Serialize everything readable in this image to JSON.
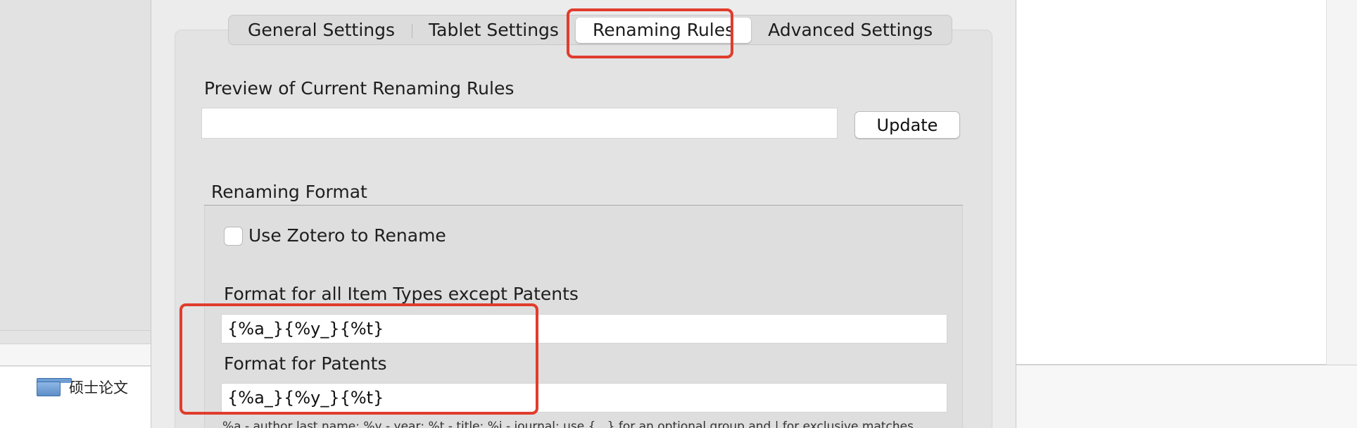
{
  "background_app": {
    "sidebar_folder_label": "硕士论文"
  },
  "tabs": [
    {
      "label": "General Settings",
      "active": false
    },
    {
      "label": "Tablet Settings",
      "active": false
    },
    {
      "label": "Renaming Rules",
      "active": true
    },
    {
      "label": "Advanced Settings",
      "active": false
    }
  ],
  "preview": {
    "label": "Preview of Current Renaming Rules",
    "value": "",
    "update_label": "Update"
  },
  "renaming_format": {
    "section_title": "Renaming Format",
    "use_zotero_label": "Use Zotero to Rename",
    "use_zotero_checked": false,
    "all_types_label": "Format for all Item Types except Patents",
    "all_types_value": "{%a_}{%y_}{%t}",
    "patents_label": "Format for Patents",
    "patents_value": "{%a_}{%y_}{%t}",
    "help_text": "%a - author last name; %y - year; %t - title; %j - journal; use {...} for an optional group and | for exclusive matches"
  },
  "annotation_color": "#e03c2d"
}
